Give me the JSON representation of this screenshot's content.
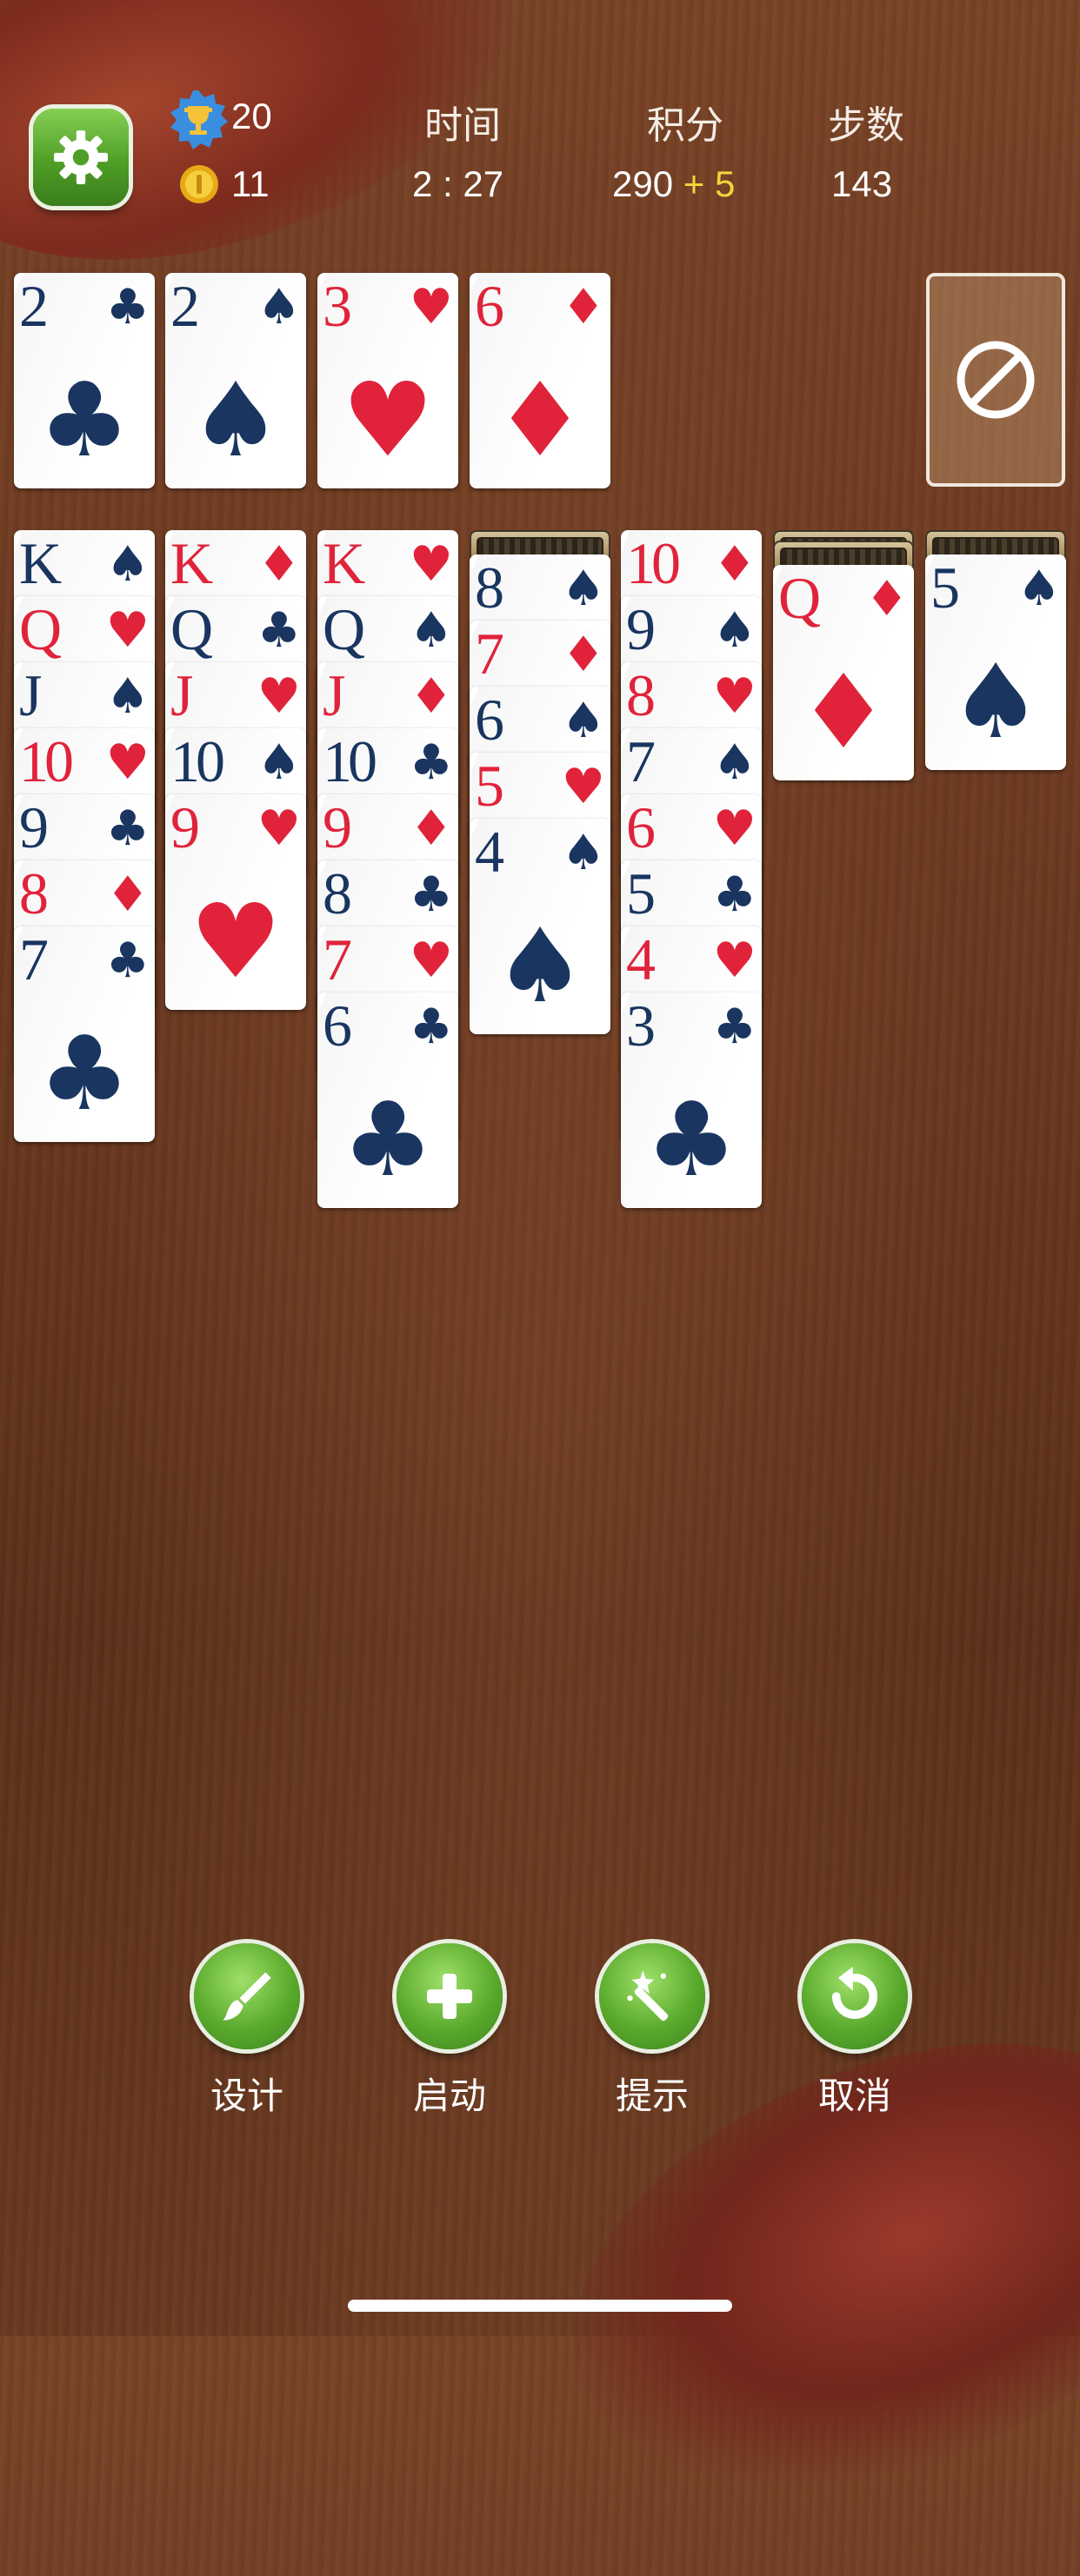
{
  "hud": {
    "trophy_count": "20",
    "coin_count": "11",
    "time_label": "时间",
    "time_value": "2 : 27",
    "score_label": "积分",
    "score_value": "290",
    "score_bonus": "+ 5",
    "moves_label": "步数",
    "moves_value": "143",
    "icons": {
      "settings": "gear-icon",
      "trophy": "trophy-icon",
      "coin": "coin-icon"
    }
  },
  "foundations": [
    {
      "rank": "2",
      "suit": "♣",
      "color": "black"
    },
    {
      "rank": "2",
      "suit": "♠",
      "color": "black"
    },
    {
      "rank": "3",
      "suit": "♥",
      "color": "red"
    },
    {
      "rank": "6",
      "suit": "♦",
      "color": "red"
    }
  ],
  "stock": {
    "state": "empty",
    "icon": "no-entry-icon"
  },
  "tableau": [
    {
      "hidden": 0,
      "cards": [
        {
          "rank": "K",
          "suit": "♠",
          "color": "black"
        },
        {
          "rank": "Q",
          "suit": "♥",
          "color": "red"
        },
        {
          "rank": "J",
          "suit": "♠",
          "color": "black"
        },
        {
          "rank": "10",
          "suit": "♥",
          "color": "red"
        },
        {
          "rank": "9",
          "suit": "♣",
          "color": "black"
        },
        {
          "rank": "8",
          "suit": "♦",
          "color": "red"
        },
        {
          "rank": "7",
          "suit": "♣",
          "color": "black"
        }
      ]
    },
    {
      "hidden": 0,
      "cards": [
        {
          "rank": "K",
          "suit": "♦",
          "color": "red"
        },
        {
          "rank": "Q",
          "suit": "♣",
          "color": "black"
        },
        {
          "rank": "J",
          "suit": "♥",
          "color": "red"
        },
        {
          "rank": "10",
          "suit": "♠",
          "color": "black"
        },
        {
          "rank": "9",
          "suit": "♥",
          "color": "red"
        }
      ]
    },
    {
      "hidden": 0,
      "cards": [
        {
          "rank": "K",
          "suit": "♥",
          "color": "red"
        },
        {
          "rank": "Q",
          "suit": "♠",
          "color": "black"
        },
        {
          "rank": "J",
          "suit": "♦",
          "color": "red"
        },
        {
          "rank": "10",
          "suit": "♣",
          "color": "black"
        },
        {
          "rank": "9",
          "suit": "♦",
          "color": "red"
        },
        {
          "rank": "8",
          "suit": "♣",
          "color": "black"
        },
        {
          "rank": "7",
          "suit": "♥",
          "color": "red"
        },
        {
          "rank": "6",
          "suit": "♣",
          "color": "black"
        }
      ]
    },
    {
      "hidden": 1,
      "cards": [
        {
          "rank": "8",
          "suit": "♠",
          "color": "black"
        },
        {
          "rank": "7",
          "suit": "♦",
          "color": "red"
        },
        {
          "rank": "6",
          "suit": "♠",
          "color": "black"
        },
        {
          "rank": "5",
          "suit": "♥",
          "color": "red"
        },
        {
          "rank": "4",
          "suit": "♠",
          "color": "black"
        }
      ]
    },
    {
      "hidden": 0,
      "cards": [
        {
          "rank": "10",
          "suit": "♦",
          "color": "red"
        },
        {
          "rank": "9",
          "suit": "♠",
          "color": "black"
        },
        {
          "rank": "8",
          "suit": "♥",
          "color": "red"
        },
        {
          "rank": "7",
          "suit": "♠",
          "color": "black"
        },
        {
          "rank": "6",
          "suit": "♥",
          "color": "red"
        },
        {
          "rank": "5",
          "suit": "♣",
          "color": "black"
        },
        {
          "rank": "4",
          "suit": "♥",
          "color": "red"
        },
        {
          "rank": "3",
          "suit": "♣",
          "color": "black"
        }
      ]
    },
    {
      "hidden": 2,
      "cards": [
        {
          "rank": "Q",
          "suit": "♦",
          "color": "red"
        }
      ]
    },
    {
      "hidden": 1,
      "cards": [
        {
          "rank": "5",
          "suit": "♠",
          "color": "black"
        }
      ]
    }
  ],
  "toolbar": {
    "design_label": "设计",
    "new_label": "启动",
    "hint_label": "提示",
    "undo_label": "取消",
    "icons": {
      "design": "paintbrush-icon",
      "new": "plus-icon",
      "hint": "magic-wand-icon",
      "undo": "undo-icon"
    }
  },
  "colors": {
    "red_suit": "#e0233a",
    "black_suit": "#193560",
    "button_green": "#5aaa2c",
    "bonus_yellow": "#f2d43c"
  }
}
